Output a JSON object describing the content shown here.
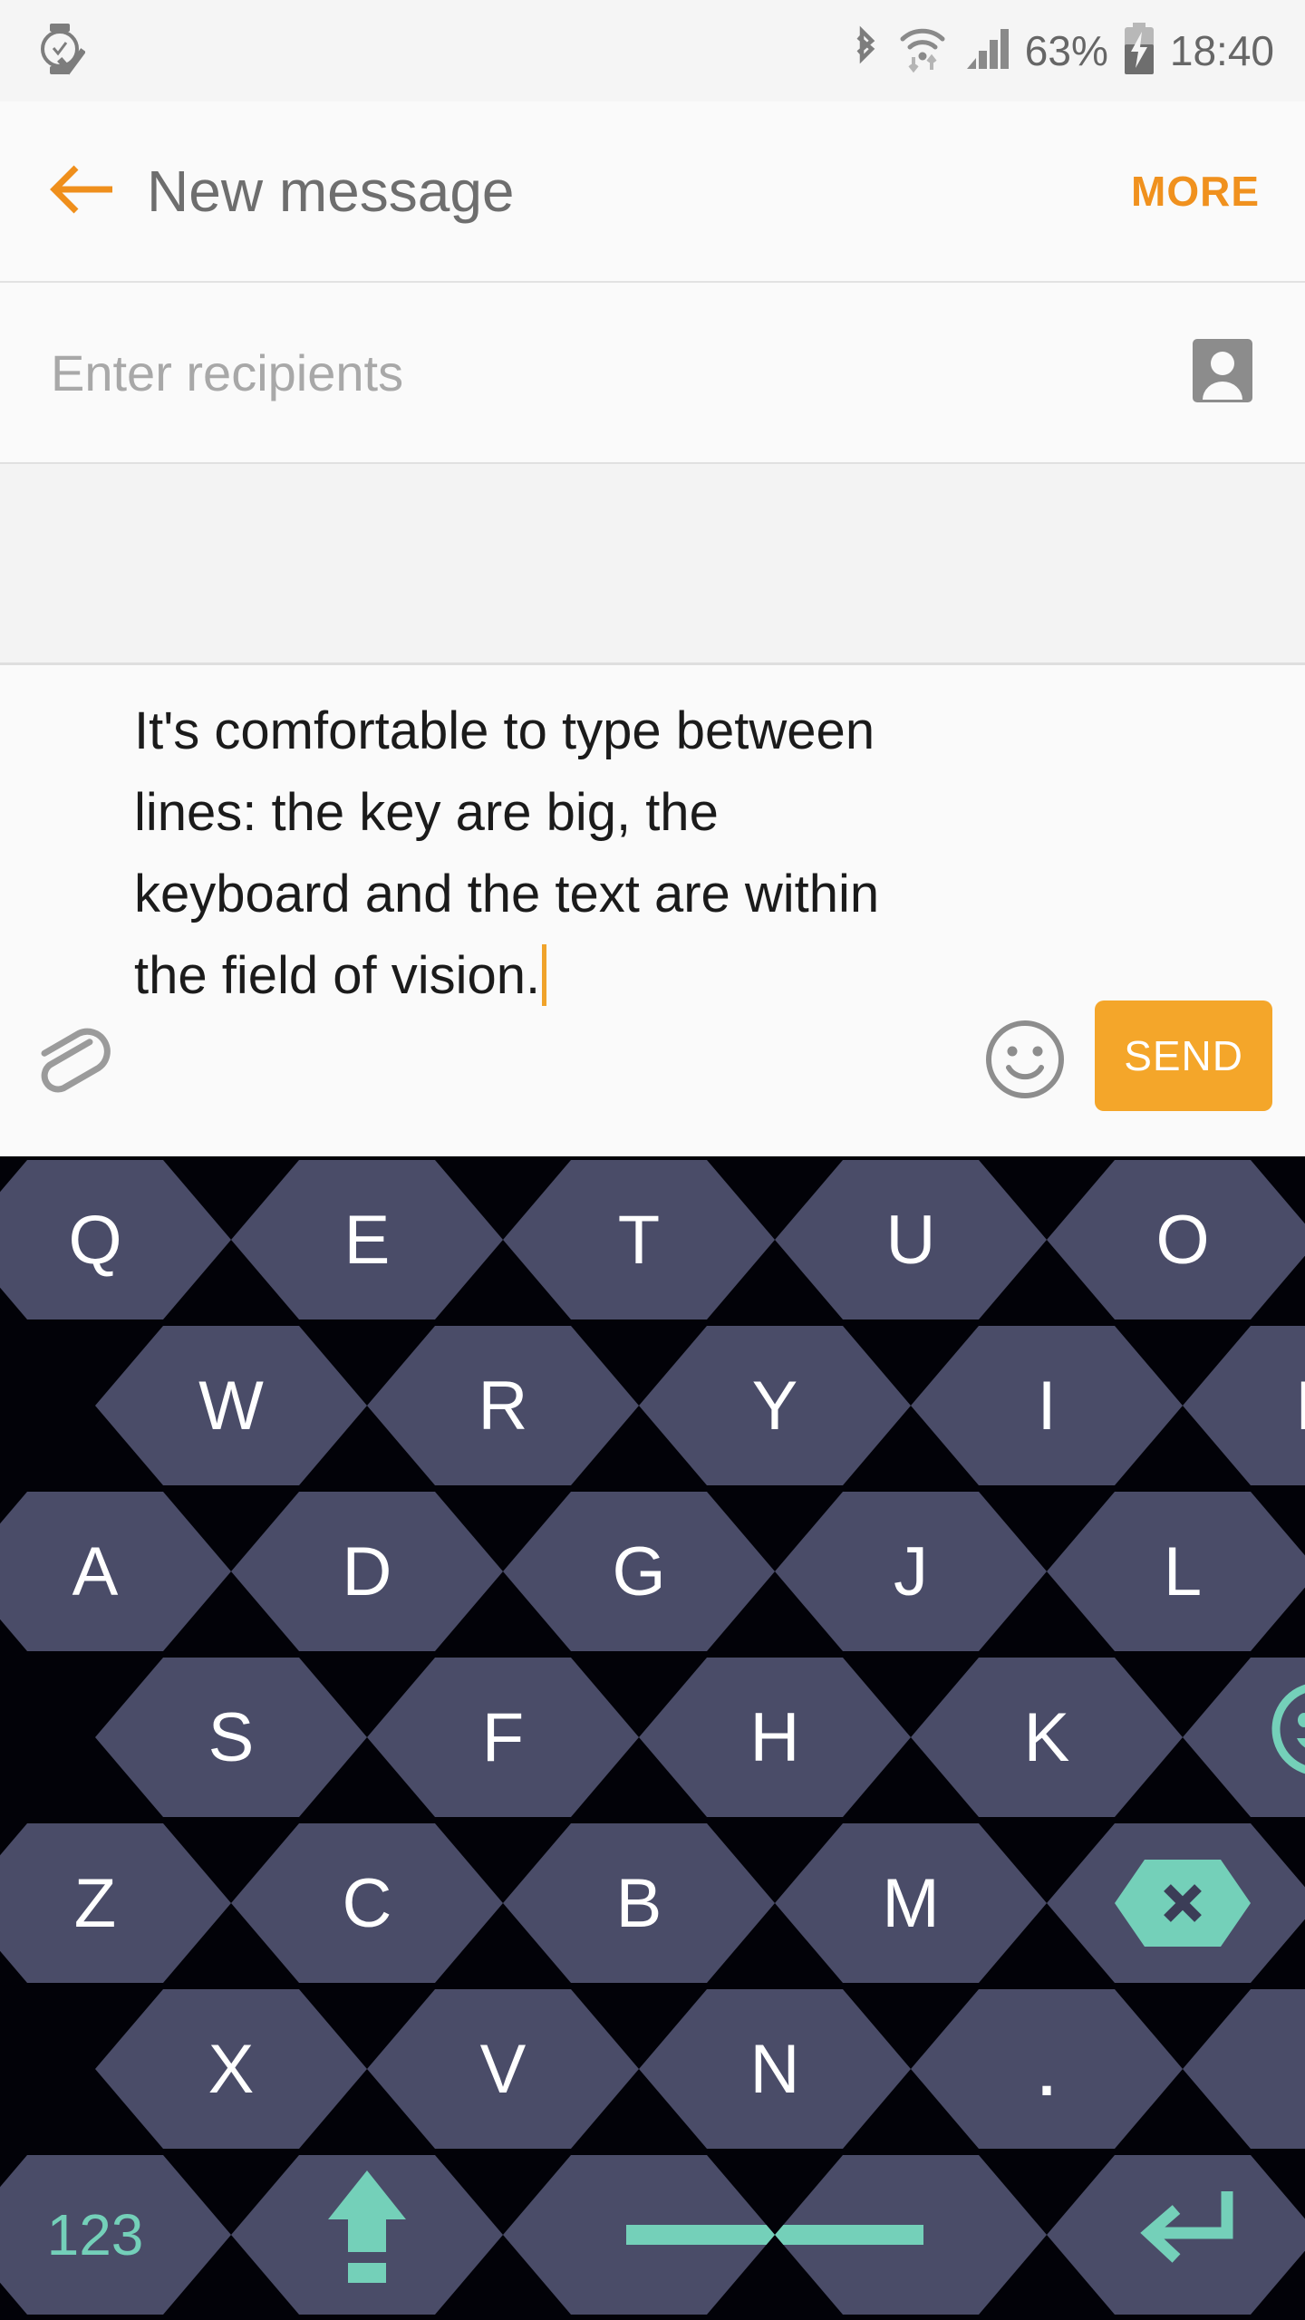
{
  "statusbar": {
    "left_icons": [
      "watch-check-icon"
    ],
    "bluetooth": "bluetooth-icon",
    "wifi": "wifi-data-icon",
    "signal": "signal-bars-icon",
    "battery_percent": "63%",
    "battery": "battery-charging-icon",
    "time": "18:40"
  },
  "appbar": {
    "back": "back-arrow-icon",
    "title": "New message",
    "more_label": "MORE",
    "accent_color": "#f0911e"
  },
  "recipients": {
    "placeholder": "Enter recipients",
    "value": "",
    "contact_icon": "contact-person-icon"
  },
  "compose": {
    "attach_icon": "paperclip-icon",
    "message": "It's comfortable to type between lines: the key are big, the keyboard and the text are within the field of vision.",
    "emoji_icon": "smiley-face-icon",
    "send_label": "SEND",
    "send_color": "#f4a62a",
    "caret_color": "#f0a32a"
  },
  "keyboard": {
    "key_color": "#4a4c68",
    "accent_color": "#74d0b9",
    "background": "#020208",
    "rows": [
      {
        "offset": 0,
        "keys": [
          {
            "label": "Q",
            "name": "key-q"
          },
          {
            "label": "E",
            "name": "key-e"
          },
          {
            "label": "T",
            "name": "key-t"
          },
          {
            "label": "U",
            "name": "key-u"
          },
          {
            "label": "O",
            "name": "key-o"
          }
        ]
      },
      {
        "offset": 1,
        "keys": [
          {
            "label": "W",
            "name": "key-w"
          },
          {
            "label": "R",
            "name": "key-r"
          },
          {
            "label": "Y",
            "name": "key-y"
          },
          {
            "label": "I",
            "name": "key-i"
          },
          {
            "label": "P",
            "name": "key-p"
          }
        ]
      },
      {
        "offset": 0,
        "keys": [
          {
            "label": "A",
            "name": "key-a"
          },
          {
            "label": "D",
            "name": "key-d"
          },
          {
            "label": "G",
            "name": "key-g"
          },
          {
            "label": "J",
            "name": "key-j"
          },
          {
            "label": "L",
            "name": "key-l"
          }
        ]
      },
      {
        "offset": 1,
        "keys": [
          {
            "label": "S",
            "name": "key-s"
          },
          {
            "label": "F",
            "name": "key-f"
          },
          {
            "label": "H",
            "name": "key-h"
          },
          {
            "label": "K",
            "name": "key-k"
          },
          {
            "label": "",
            "name": "key-emoji",
            "icon": "emoji-smiley-icon"
          }
        ]
      },
      {
        "offset": 0,
        "keys": [
          {
            "label": "Z",
            "name": "key-z"
          },
          {
            "label": "C",
            "name": "key-c"
          },
          {
            "label": "B",
            "name": "key-b"
          },
          {
            "label": "M",
            "name": "key-m"
          },
          {
            "label": "",
            "name": "key-backspace",
            "icon": "backspace-x-icon"
          }
        ]
      },
      {
        "offset": 1,
        "keys": [
          {
            "label": "X",
            "name": "key-x"
          },
          {
            "label": "V",
            "name": "key-v"
          },
          {
            "label": "N",
            "name": "key-n"
          },
          {
            "label": ".",
            "name": "key-period"
          },
          {
            "label": ",",
            "name": "key-comma"
          }
        ]
      },
      {
        "offset": 0,
        "keys": [
          {
            "label": "123",
            "name": "key-numbers"
          },
          {
            "label": "",
            "name": "key-shift",
            "icon": "shift-arrow-icon"
          },
          {
            "label": "",
            "name": "key-space-left",
            "icon": "space-bar-icon"
          },
          {
            "label": "",
            "name": "key-space-right",
            "icon": "space-bar-icon"
          },
          {
            "label": "",
            "name": "key-enter",
            "icon": "enter-return-icon"
          }
        ]
      }
    ]
  }
}
